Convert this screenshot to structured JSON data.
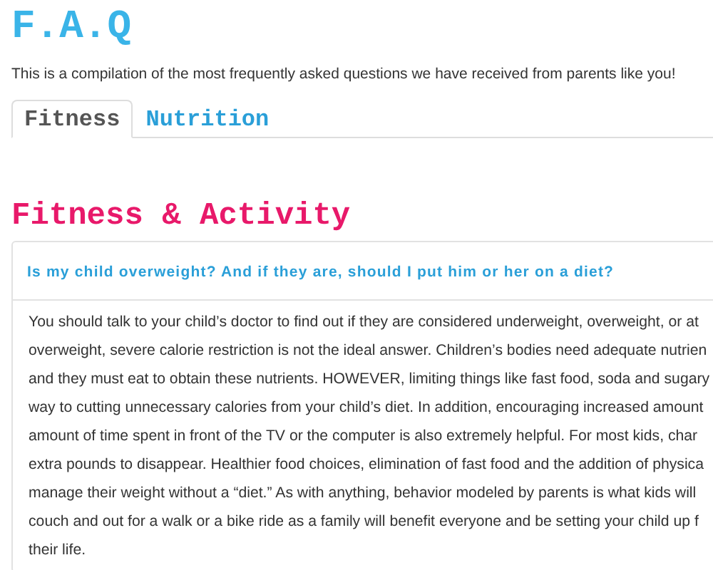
{
  "page": {
    "title": "F.A.Q",
    "intro": "This is a compilation of the most frequently asked questions we have received from parents like you!"
  },
  "tabs": [
    {
      "label": "Fitness",
      "selected": true
    },
    {
      "label": "Nutrition",
      "selected": false
    }
  ],
  "section": {
    "heading": "Fitness & Activity",
    "faq": {
      "question": "Is my child overweight? And if they are, should I put him or her on a diet?",
      "answer_lines": [
        "You should talk to your child’s doctor to find out if they are considered underweight, overweight, or at",
        "overweight, severe calorie restriction is not the ideal answer. Children’s bodies need adequate nutrien",
        "and they must eat to obtain these nutrients. HOWEVER, limiting things like fast food, soda and sugary",
        "way to cutting unnecessary calories from your child’s diet. In addition, encouraging increased amount",
        "amount of time spent in front of the TV or the computer is also extremely helpful. For most kids, char",
        "extra pounds to disappear. Healthier food choices, elimination of fast food and the addition of physica",
        "manage their weight without a “diet.” As with anything, behavior modeled by parents is what kids will",
        "couch and out for a walk or a bike ride as a family will benefit everyone and be setting your child up f",
        "their life."
      ]
    }
  }
}
